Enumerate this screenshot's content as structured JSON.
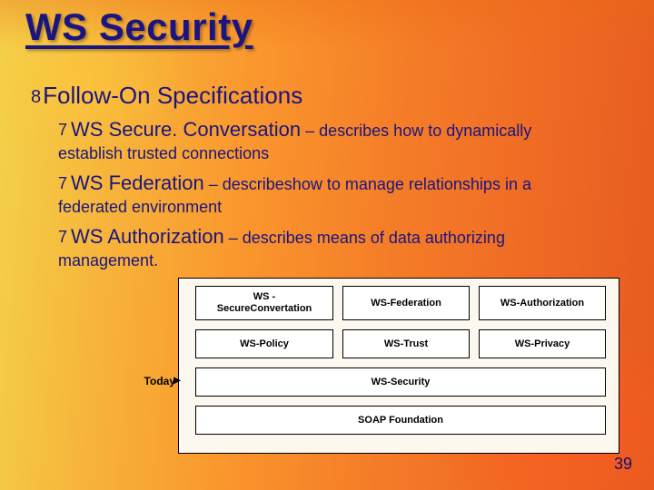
{
  "title": "WS Security",
  "section": "Follow-On Specifications",
  "bullets": {
    "b8": "8",
    "b7": "7"
  },
  "items": [
    {
      "term": "WS Secure. Conversation",
      "dash": " – ",
      "desc_lead": "describes how to dynamically",
      "desc_rest": "establish trusted connections"
    },
    {
      "term": "WS Federation",
      "dash": " – ",
      "desc_lead": "describeshow to manage relationships in a",
      "desc_rest": "federated environment"
    },
    {
      "term": "WS Authorization",
      "dash": " – ",
      "desc_lead": "describes means of data authorizing",
      "desc_rest": "management."
    }
  ],
  "diagram": {
    "today": "Today",
    "arrow": "▸",
    "row1": [
      "WS -\nSecureConvertation",
      "WS-Federation",
      "WS-Authorization"
    ],
    "row2": [
      "WS-Policy",
      "WS-Trust",
      "WS-Privacy"
    ],
    "row3": "WS-Security",
    "row4": "SOAP Foundation"
  },
  "page": "39"
}
